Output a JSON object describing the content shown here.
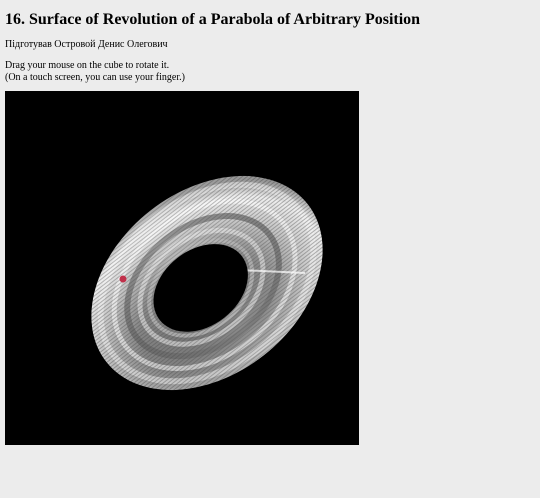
{
  "page": {
    "title": "16. Surface of Revolution of a Parabola of Arbitrary Position",
    "author": "Підготував Островой Денис Олегович",
    "instructions": [
      "Drag your mouse on the cube to rotate it.",
      "(On a touch screen, you can use your finger.)"
    ]
  },
  "scene": {
    "background": "#000000",
    "surface_color": "#d9d9d9",
    "marker_color": "#c0304a"
  }
}
